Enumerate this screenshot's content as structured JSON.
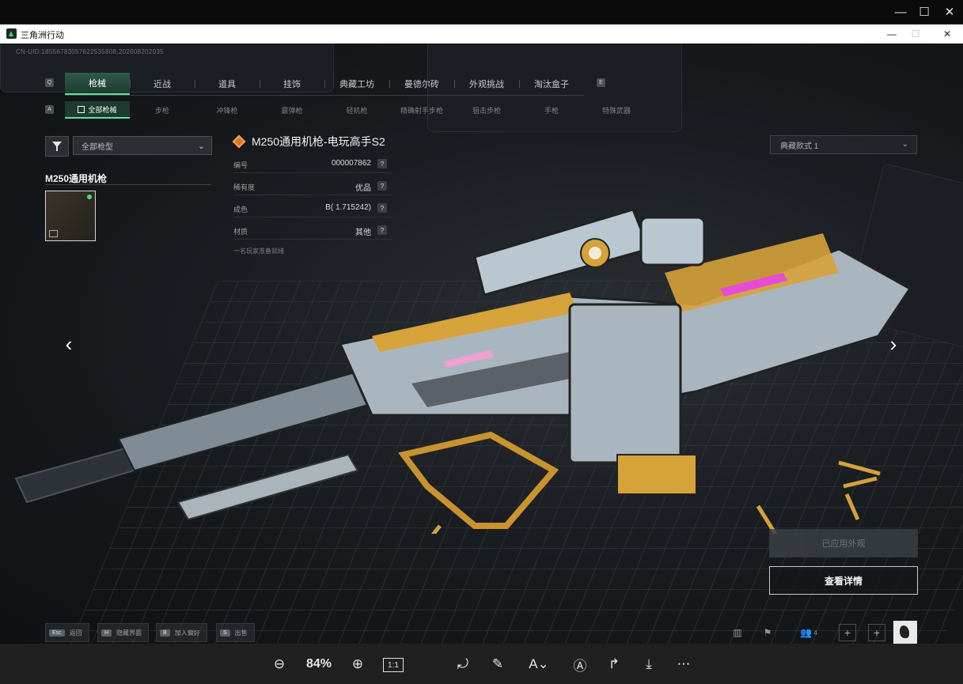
{
  "viewer": {
    "minimize": "—",
    "maximize": "☐",
    "close": "✕",
    "zoom": "84%",
    "actual_size": "1:1"
  },
  "window": {
    "title": "三角洲行动",
    "minimize": "—",
    "maximize": "☐",
    "close": "✕"
  },
  "uid": "CN-UID:18556783057622535808,202608202035",
  "tabs": [
    {
      "label": "枪械"
    },
    {
      "label": "近战"
    },
    {
      "label": "道具"
    },
    {
      "label": "挂饰"
    },
    {
      "label": "典藏工坊"
    },
    {
      "label": "曼德尔砖"
    },
    {
      "label": "外观挑战"
    },
    {
      "label": "淘汰盒子"
    }
  ],
  "tab_keys": {
    "left": "Q",
    "right": "E"
  },
  "subtab_key": "A",
  "subtabs": [
    {
      "label": "全部枪械"
    },
    {
      "label": "步枪"
    },
    {
      "label": "冲锋枪"
    },
    {
      "label": "霰弹枪"
    },
    {
      "label": "轻机枪"
    },
    {
      "label": "精确射手步枪"
    },
    {
      "label": "狙击步枪"
    },
    {
      "label": "手枪"
    },
    {
      "label": "特殊武器"
    }
  ],
  "filter": {
    "selected": "全部枪型"
  },
  "category": {
    "title": "M250通用机枪"
  },
  "item": {
    "title": "M250通用机枪-电玩高手S2",
    "rows": [
      {
        "label": "编号",
        "value": "000007862"
      },
      {
        "label": "稀有度",
        "value": "优品"
      },
      {
        "label": "成色",
        "value": "B( 1.715242)"
      },
      {
        "label": "材质",
        "value": "其他"
      }
    ],
    "ready": "一名玩家准备就绪"
  },
  "variant": {
    "selected": "典藏款式 1"
  },
  "buttons": {
    "applied": "已应用外观",
    "detail": "查看详情"
  },
  "hints": [
    {
      "key": "Esc",
      "label": "返回"
    },
    {
      "key": "H",
      "label": "隐藏界面"
    },
    {
      "key": "B",
      "label": "加入偏好"
    },
    {
      "key": "S",
      "label": "出售"
    }
  ],
  "friends_count": "4",
  "colors": {
    "accent": "#5fe3a1",
    "gold": "#d6a23a",
    "panel": "#2a2f34"
  }
}
